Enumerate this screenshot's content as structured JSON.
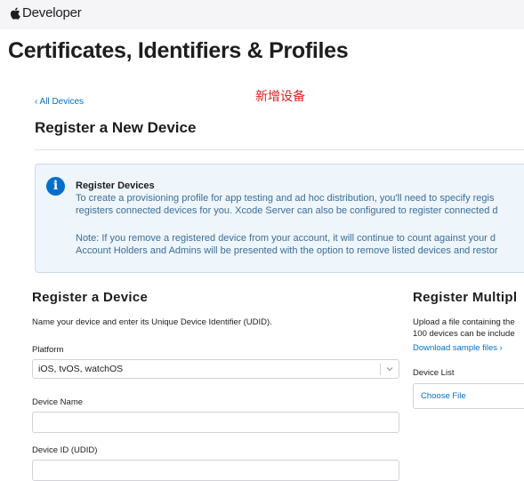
{
  "header": {
    "brand": "Developer",
    "page_title": "Certificates, Identifiers & Profiles"
  },
  "nav": {
    "back_link": "‹ All Devices"
  },
  "annotation": "新增设备",
  "section": {
    "title": "Register a New Device"
  },
  "notice": {
    "title": "Register Devices",
    "lines": [
      "To create a provisioning profile for app testing and ad hoc distribution, you'll need to specify regis",
      "registers connected devices for you. Xcode Server can also be configured to register connected d",
      "Note: If you remove a registered device from your account, it will continue to count against your d",
      "Account Holders and Admins will be presented with the option to remove listed devices and restor"
    ]
  },
  "register_device": {
    "heading": "Register a Device",
    "description": "Name your device and enter its Unique Device Identifier (UDID).",
    "platform_label": "Platform",
    "platform_value": "iOS, tvOS, watchOS",
    "device_name_label": "Device Name",
    "device_name_value": "",
    "device_id_label": "Device ID (UDID)",
    "device_id_value": ""
  },
  "register_multiple": {
    "heading": "Register Multipl",
    "description_lines": [
      "Upload a file containing the",
      "100 devices can be include"
    ],
    "sample_link": "Download sample files ›",
    "device_list_label": "Device List",
    "choose_file": "Choose File"
  },
  "colors": {
    "accent": "#0070c9",
    "annotation": "#e02020",
    "notice_bg": "#eef5fb",
    "notice_text": "#3b6e99"
  }
}
